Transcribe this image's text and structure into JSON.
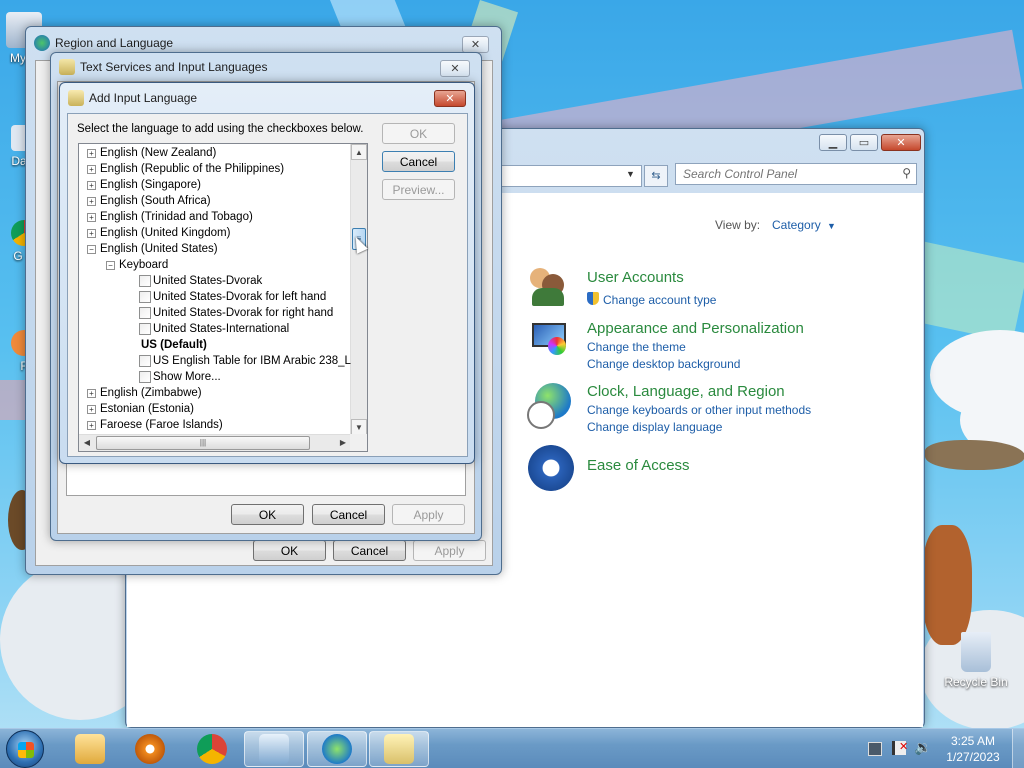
{
  "desktop": {
    "icons": [
      {
        "label": "My C"
      },
      {
        "label": "Data"
      },
      {
        "label": "G C"
      },
      {
        "label": "F"
      },
      {
        "label": "Recycle Bin"
      }
    ]
  },
  "region_window": {
    "title": "Region and Language",
    "ok": "OK",
    "cancel": "Cancel",
    "apply": "Apply"
  },
  "text_services_window": {
    "title": "Text Services and Input Languages",
    "ok": "OK",
    "cancel": "Cancel",
    "apply": "Apply"
  },
  "add_input_dialog": {
    "title": "Add Input Language",
    "instruction": "Select the language to add using the checkboxes below.",
    "ok": "OK",
    "cancel": "Cancel",
    "preview": "Preview...",
    "tree": [
      {
        "kind": "lang",
        "label": "English (New Zealand)",
        "exp": "+"
      },
      {
        "kind": "lang",
        "label": "English (Republic of the Philippines)",
        "exp": "+"
      },
      {
        "kind": "lang",
        "label": "English (Singapore)",
        "exp": "+"
      },
      {
        "kind": "lang",
        "label": "English (South Africa)",
        "exp": "+"
      },
      {
        "kind": "lang",
        "label": "English (Trinidad and Tobago)",
        "exp": "+"
      },
      {
        "kind": "lang",
        "label": "English (United Kingdom)",
        "exp": "+"
      },
      {
        "kind": "lang",
        "label": "English (United States)",
        "exp": "−"
      },
      {
        "kind": "group",
        "label": "Keyboard",
        "exp": "−"
      },
      {
        "kind": "item",
        "label": "United States-Dvorak"
      },
      {
        "kind": "item",
        "label": "United States-Dvorak for left hand"
      },
      {
        "kind": "item",
        "label": "United States-Dvorak for right hand"
      },
      {
        "kind": "item",
        "label": "United States-International"
      },
      {
        "kind": "default",
        "label": "US (Default)"
      },
      {
        "kind": "item",
        "label": "US English Table for IBM Arabic 238_L"
      },
      {
        "kind": "item",
        "label": "Show More..."
      },
      {
        "kind": "lang",
        "label": "English (Zimbabwe)",
        "exp": "+"
      },
      {
        "kind": "lang",
        "label": "Estonian (Estonia)",
        "exp": "+"
      },
      {
        "kind": "lang",
        "label": "Faroese (Faroe Islands)",
        "exp": "+"
      }
    ]
  },
  "control_panel": {
    "search_placeholder": "Search Control Panel",
    "view_by_label": "View by:",
    "view_by_value": "Category",
    "sections": [
      {
        "title": "User Accounts",
        "links": [
          "Change account type"
        ]
      },
      {
        "title": "Appearance and Personalization",
        "links": [
          "Change the theme",
          "Change desktop background"
        ]
      },
      {
        "title": "Clock, Language, and Region",
        "links": [
          "Change keyboards or other input methods",
          "Change display language"
        ]
      },
      {
        "title": "Ease of Access",
        "links": []
      }
    ]
  },
  "taskbar": {
    "time": "3:25 AM",
    "date": "1/27/2023",
    "apps": [
      "start-orb",
      "explorer",
      "media-player",
      "chrome",
      "control-panel",
      "region-language",
      "text-services"
    ]
  }
}
